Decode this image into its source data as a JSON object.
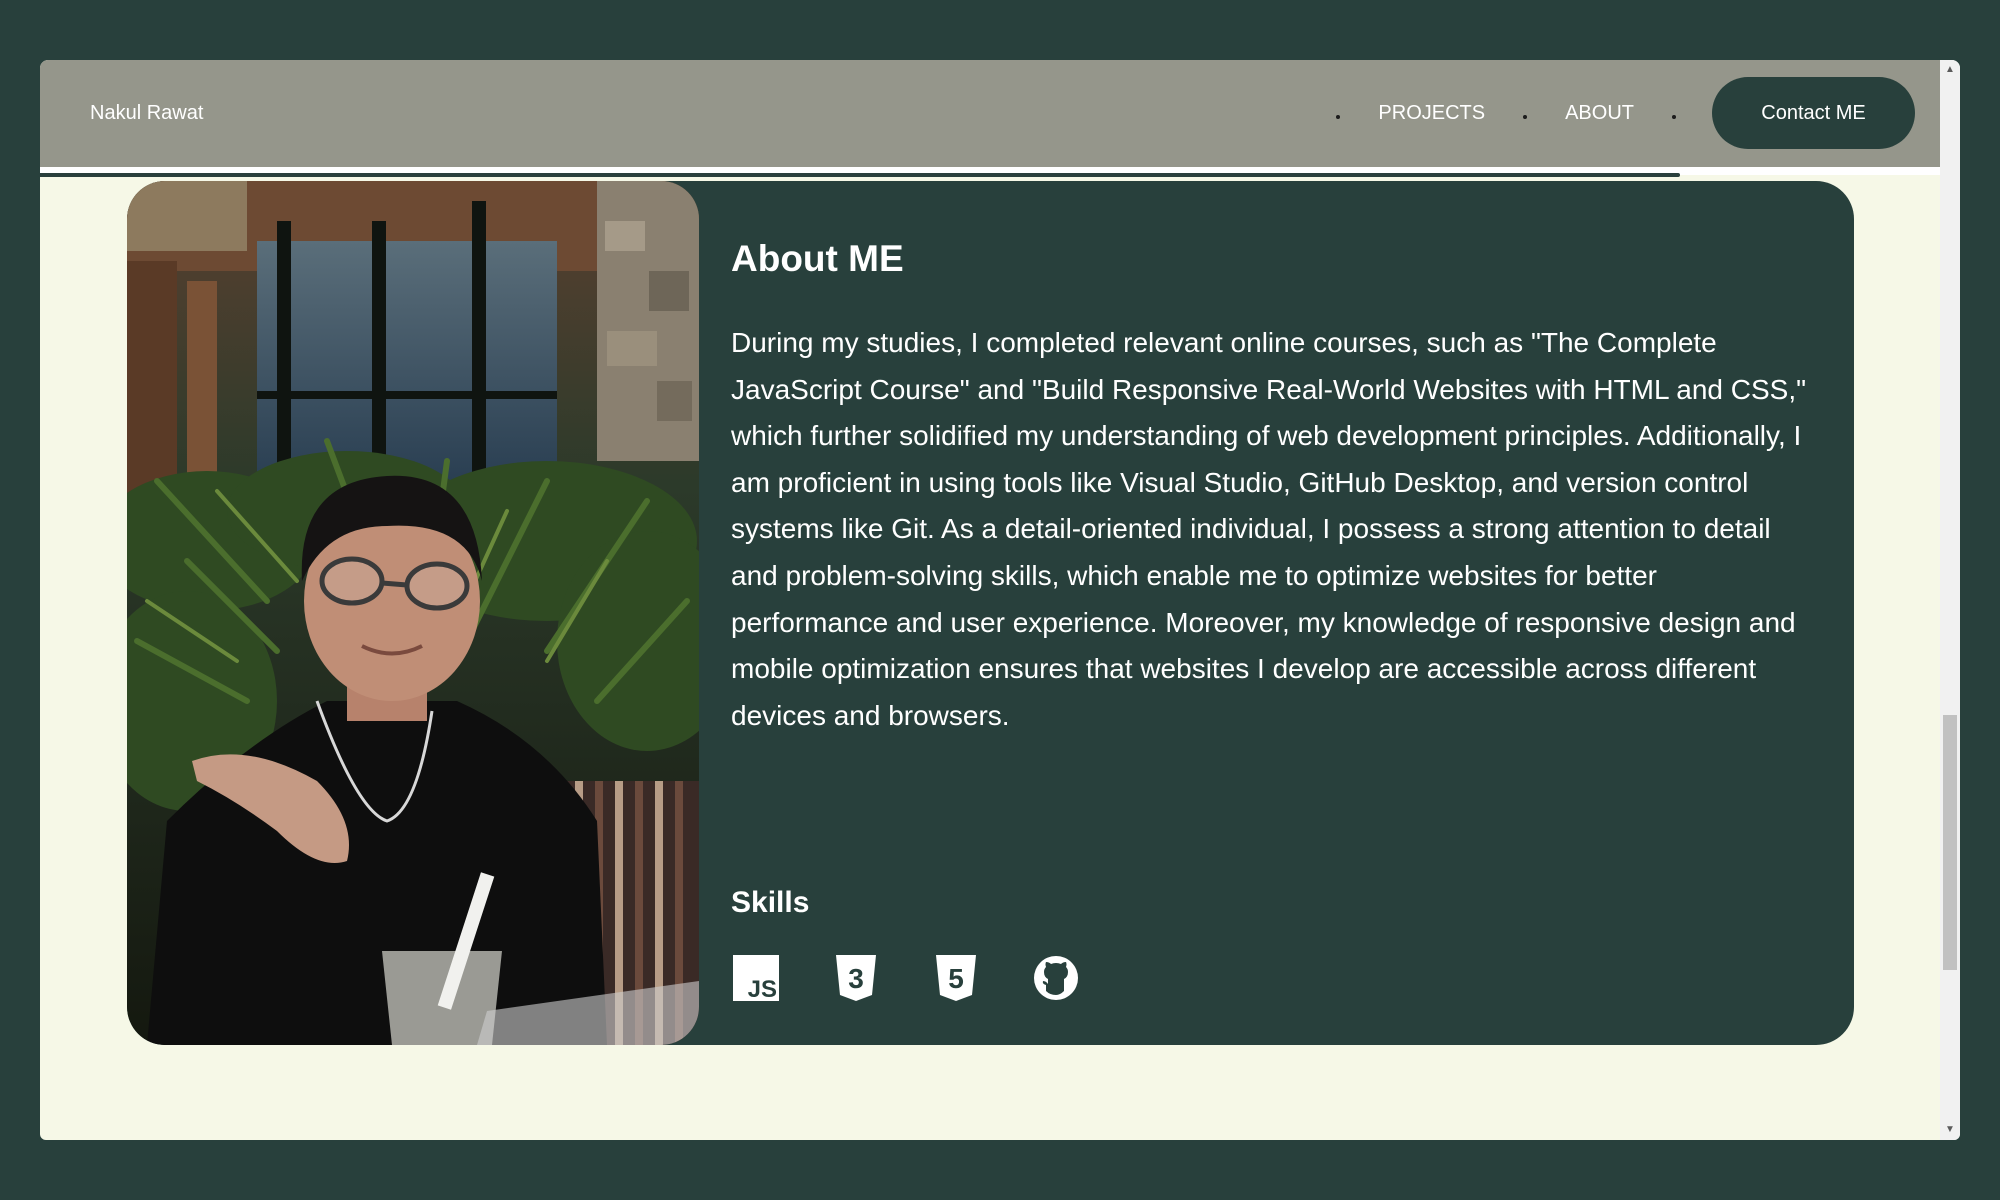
{
  "nav": {
    "brand": "Nakul Rawat",
    "links": [
      "PROJECTS",
      "ABOUT"
    ],
    "contact_label": "Contact ME"
  },
  "reading_progress": 0.863,
  "about": {
    "title": "About ME",
    "text": "During my studies, I completed relevant online courses, such as \"The Complete JavaScript Course\" and \"Build Responsive Real-World Websites with HTML and CSS,\" which further solidified my understanding of web development principles. Additionally, I am proficient in using tools like Visual Studio, GitHub Desktop, and version control systems like Git. As a detail-oriented individual, I possess a strong attention to detail and problem-solving skills, which enable me to optimize websites for better performance and user experience. Moreover, my knowledge of responsive design and mobile optimization ensures that websites I develop are accessible across different devices and browsers.",
    "photo_icon": "profile-photo",
    "skills_title": "Skills",
    "skills": [
      {
        "icon": "javascript-icon",
        "label": "JS"
      },
      {
        "icon": "css3-icon",
        "label": "3"
      },
      {
        "icon": "html5-icon",
        "label": "5"
      },
      {
        "icon": "github-icon"
      }
    ]
  },
  "colors": {
    "page_bg": "#28403c",
    "content_bg": "#f6f8e7",
    "navbar_bg": "#95968b",
    "card_bg": "#28403c",
    "text": "#ffffff"
  }
}
